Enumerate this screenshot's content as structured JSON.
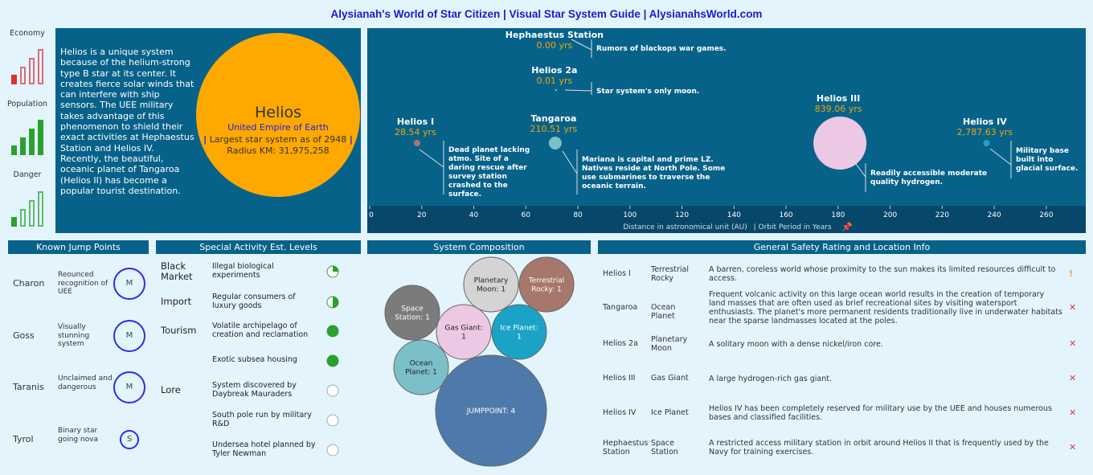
{
  "header": {
    "title": "Alysianah's World of Star Citizen  |  Visual Star System Guide  |  AlysianahsWorld.com"
  },
  "indicators": [
    {
      "label": "Economy",
      "level": 1,
      "max": 4,
      "color": "#d9303a"
    },
    {
      "label": "Population",
      "level": 4,
      "max": 4,
      "color": "#2ca02c"
    },
    {
      "label": "Danger",
      "level": 1,
      "max": 4,
      "color": "#2ca02c"
    }
  ],
  "description": "Helios is a unique system because of the helium-strong type B star at its center. It creates fierce solar winds that can interfere with ship sensors. The UEE military takes advantage of this phenomenon to shield their exact activities at Hephaestus Station and Helios IV. Recently, the beautiful, oceanic planet of Tangaroa (Helios II) has become a popular tourist destination.",
  "star": {
    "name": "Helios",
    "affiliation": "United Empire of Earth",
    "note_pipe": "|",
    "note": "Largest star system as of 2948",
    "radius": "Radius KM: 31,975,258",
    "color": "#ffa800"
  },
  "chart_data": [
    {
      "type": "scatter",
      "xlabel": "Distance in astronomical unit (AU)",
      "xlabel_suffix": "| Orbit Period in Years",
      "xlim": [
        0,
        275
      ],
      "xticks": [
        0,
        20,
        40,
        60,
        80,
        100,
        120,
        140,
        160,
        180,
        200,
        220,
        240,
        260
      ],
      "grid": false,
      "points": [
        {
          "name": "Hephaestus Station",
          "distance_au": 71.6,
          "period_label": "0.00 yrs",
          "note": "Rumors of blackops war games.",
          "color": "#7b7b7b"
        },
        {
          "name": "Helios 2a",
          "distance_au": 71.6,
          "period_label": "0.01 yrs",
          "note": "Star system's only moon.",
          "color": "#d4d4d4"
        },
        {
          "name": "Helios I",
          "distance_au": 18.2,
          "period_label": "28.54 yrs",
          "note": "Dead planet lacking atmo. Site of a daring rescue after survey station crashed to the surface.",
          "color": "#a8776b"
        },
        {
          "name": "Tangaroa",
          "distance_au": 71.3,
          "period_label": "210.51 yrs",
          "note": "Mariana is capital and prime LZ. Natives reside at North Pole. Some use submarines to traverse the oceanic terrain.",
          "color": "#7bbfc9"
        },
        {
          "name": "Helios III",
          "distance_au": 180.7,
          "period_label": "839.06 yrs",
          "note": "Readily accessible moderate quality hydrogen.",
          "color": "#edc8e4"
        },
        {
          "name": "Helios IV",
          "distance_au": 237.0,
          "period_label": "2,787.63 yrs",
          "note": "Military base built into glacial surface.",
          "color": "#1aa3c7"
        }
      ]
    },
    {
      "type": "bubble",
      "title": "System Composition",
      "items": [
        {
          "label": "Planetary Moon: 1",
          "value": 1,
          "color": "#d4d4d4"
        },
        {
          "label": "Terrestrial Rocky: 1",
          "value": 1,
          "color": "#a8776b"
        },
        {
          "label": "Space Station: 1",
          "value": 1,
          "color": "#7b7b7b"
        },
        {
          "label": "Gas Giant: 1",
          "value": 1,
          "color": "#edc8e4"
        },
        {
          "label": "Ice Planet: 1",
          "value": 1,
          "color": "#1aa3c7"
        },
        {
          "label": "Ocean Planet: 1",
          "value": 1,
          "color": "#7bbfc9"
        },
        {
          "label": "JUMPPOINT: 4",
          "value": 4,
          "color": "#4e7aab"
        }
      ]
    }
  ],
  "jump_points": {
    "title": "Known Jump Points",
    "items": [
      {
        "name": "Charon",
        "desc": "Reounced recognition of UEE",
        "size": "M"
      },
      {
        "name": "Goss",
        "desc": "Visually stunning system",
        "size": "M"
      },
      {
        "name": "Taranis",
        "desc": "Unclaimed and dangerous",
        "size": "M"
      },
      {
        "name": "Tyrol",
        "desc": "Binary star going nova",
        "size": "S"
      }
    ]
  },
  "activity": {
    "title": "Special Activity Est. Levels",
    "items": [
      {
        "category": "Black Market",
        "desc": "Illegal biological experiments",
        "level": 0.25
      },
      {
        "category": "Import",
        "desc": "Regular consumers of luxury goods",
        "level": 0.5
      },
      {
        "category": "Tourism",
        "desc": "Volatile archipelago of creation and reclamation",
        "level": 1
      },
      {
        "category": "",
        "desc": "Exotic subsea housing",
        "level": 1
      },
      {
        "category": "Lore",
        "desc": "System discovered by Daybreak Mauraders",
        "level": 0
      },
      {
        "category": "",
        "desc": "South pole run by military R&D",
        "level": 0
      },
      {
        "category": "",
        "desc": "Undersea hotel planned by Tyler Newman",
        "level": 0
      }
    ]
  },
  "safety": {
    "title": "General Safety Rating and Location Info",
    "rows": [
      {
        "name": "Helios I",
        "type": "Terrestrial Rocky",
        "info": "A barren, coreless world whose proximity to the sun makes its limited resources difficult to access.",
        "rating": "!",
        "rating_color": "#f0a040"
      },
      {
        "name": "Tangaroa",
        "type": "Ocean Planet",
        "info": "Frequent volcanic activity on this large ocean world results in the creation of temporary land masses that are often used as brief recreational sites by visiting watersport enthusiasts. The planet's more permanent residents traditionally live in underwater habitats near the sparse landmasses located at the poles.",
        "rating": "✕",
        "rating_color": "#e03c3c"
      },
      {
        "name": "Helios 2a",
        "type": "Planetary Moon",
        "info": "A solitary moon with a dense nickel/iron core.",
        "rating": "✕",
        "rating_color": "#e03c3c"
      },
      {
        "name": "Helios III",
        "type": "Gas Giant",
        "info": "A large hydrogen-rich gas giant.",
        "rating": "✕",
        "rating_color": "#e03c3c"
      },
      {
        "name": "Helios IV",
        "type": "Ice Planet",
        "info": "Helios IV has been completely reserved for military use by the UEE and houses numerous bases and classified facilities.",
        "rating": "✕",
        "rating_color": "#e03c3c"
      },
      {
        "name": "Hephaestus Station",
        "type": "Space Station",
        "info": "A restricted access military station in orbit around Helios II that is frequently used by the Navy for training exercises.",
        "rating": "✕",
        "rating_color": "#e03c3c"
      }
    ]
  },
  "colors": {
    "panel": "#07628a",
    "axis_band": "#06476a",
    "background": "#e3f4fd",
    "period": "#f0a500",
    "title": "#1a1ad0"
  }
}
